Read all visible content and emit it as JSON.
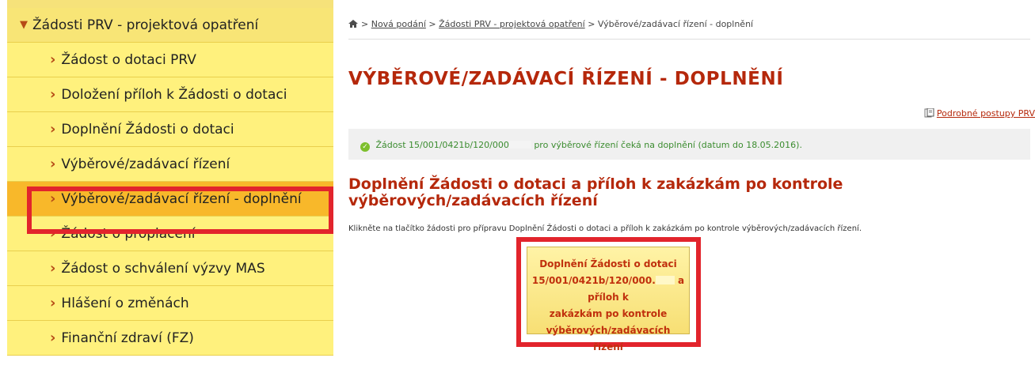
{
  "sidebar": {
    "parent": "Žádosti PRV - projektová opatření",
    "items": [
      "Žádost o dotaci PRV",
      "Doložení příloh k Žádosti o dotaci",
      "Doplnění Žádosti o dotaci",
      "Výběrové/zadávací řízení",
      "Výběrové/zadávací řízení - doplnění",
      "Žádost o proplacení",
      "Žádost o schválení výzvy MAS",
      "Hlášení o změnách",
      "Finanční zdraví (FZ)"
    ]
  },
  "breadcrumb": {
    "b1": "Nová podání",
    "b2": "Žádosti PRV - projektová opatření",
    "current": "Výběrové/zadávací řízení - doplnění",
    "sep": ">"
  },
  "page": {
    "title": "VÝBĚROVÉ/ZADÁVACÍ ŘÍZENÍ - DOPLNĚNÍ",
    "guide_link": "Podrobné postupy PRV",
    "info_part1": "Žádost 15/001/0421b/120/000",
    "info_part2": "pro výběrové řízení čeká na doplnění (datum do 18.05.2016).",
    "section_title": "Doplnění Žádosti o dotaci a příloh k zakázkám po kontrole výběrových/zadávacích řízení",
    "hint": "Klikněte na tlačítko žádosti pro přípravu Doplnění Žádosti o dotaci a příloh k zakázkám po kontrole výběrových/zadávacích řízení."
  },
  "cta": {
    "line1": "Doplnění Žádosti o dotaci",
    "line2a": "15/001/0421b/120/000.",
    "line2b": "a příloh k",
    "line3": "zakázkám po kontrole výběrových/zadávacích",
    "line4": "řízení"
  },
  "colors": {
    "accent": "#b5280b",
    "highlight": "#e2242c",
    "nav_bg": "#fff17d",
    "nav_active": "#f8b82a",
    "success": "#3b8c2f"
  }
}
